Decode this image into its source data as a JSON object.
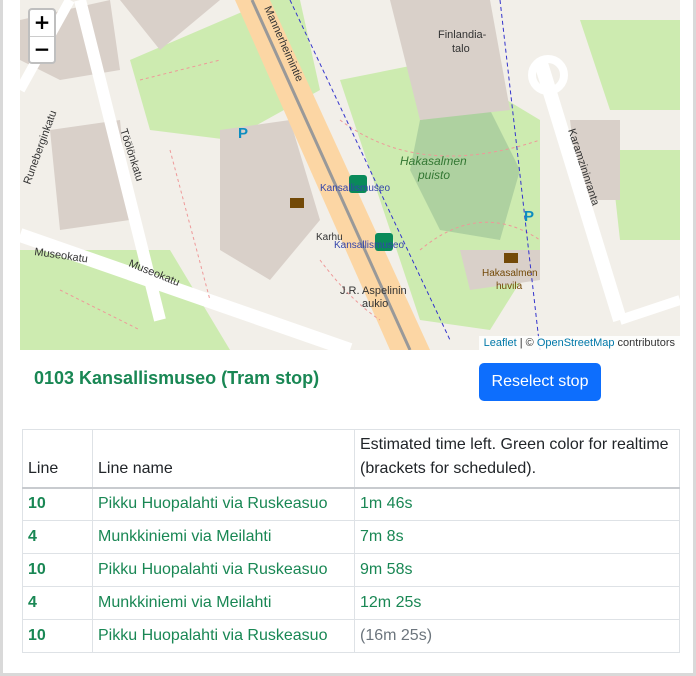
{
  "map": {
    "zoom_in": "+",
    "zoom_out": "−",
    "labels": {
      "finlandia": "Finlandia-",
      "talo": "talo",
      "hakasalmen": "Hakasalmen",
      "puisto": "puisto",
      "kansallismuseo1": "Kansallismuseo",
      "kansallismuseo2": "Kansallismuseo",
      "karhu": "Karhu",
      "aspelinin": "J.R. Aspelinin",
      "aukio": "aukio",
      "huvila1": "Hakasalmen",
      "huvila2": "huvila",
      "museokatu1": "Museokatu",
      "museokatu2": "Museokatu",
      "toolonkatu": "Töölönkatu",
      "runeberginkatu": "Runeberginkatu",
      "karamzininranta": "Karamzininranta",
      "mannerheimintie": "Mannerheimintie",
      "parking": "P"
    },
    "attribution": {
      "leaflet": "Leaflet",
      "sep": " | © ",
      "osm": "OpenStreetMap",
      "tail": " contributors"
    }
  },
  "stop": {
    "title": "0103 Kansallismuseo (Tram stop)",
    "reselect_label": "Reselect stop"
  },
  "table": {
    "headers": {
      "line": "Line",
      "name": "Line name",
      "time": "Estimated time left. Green color for realtime (brackets for scheduled)."
    },
    "rows": [
      {
        "line": "10",
        "name": "Pikku Huopalahti via Ruskeasuo",
        "time": "1m 46s"
      },
      {
        "line": "4",
        "name": "Munkkiniemi via Meilahti",
        "time": "7m 8s"
      },
      {
        "line": "10",
        "name": "Pikku Huopalahti via Ruskeasuo",
        "time": "9m 58s"
      },
      {
        "line": "4",
        "name": "Munkkiniemi via Meilahti",
        "time": "12m 25s"
      },
      {
        "line": "10",
        "name": "Pikku Huopalahti via Ruskeasuo",
        "time": "(16m 25s)"
      }
    ]
  }
}
